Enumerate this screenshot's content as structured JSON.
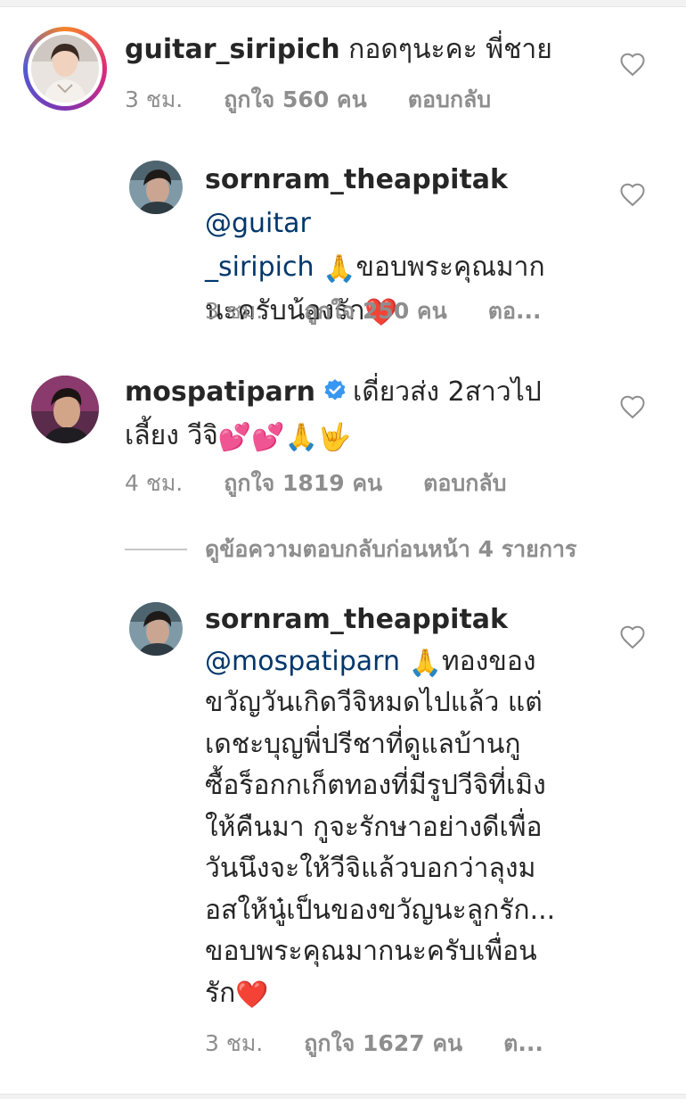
{
  "comments": [
    {
      "username": "guitar_siripich",
      "text": "กอดๆนะคะ พี่ชาย",
      "time": "3 ชม.",
      "likes": "ถูกใจ 560 คน",
      "reply": "ตอบกลับ"
    },
    {
      "username": "sornram_theappitak",
      "mention_part1": "@guitar",
      "mention_part2": "_siripich",
      "line2_text": "ขอบพระคุณมาก",
      "line3_text": "นะครับน้องรัก",
      "emoji_pray": "🙏",
      "emoji_heart": "❤️",
      "time": "3 ชม.",
      "likes": "ถูกใจ 250 คน",
      "reply": "ตอ..."
    },
    {
      "username": "mospatiparn",
      "line1_text": "เดี่ยวส่ง 2สาวไป",
      "line2_text": "เลี้ยง วีจิ",
      "emojis": "💕💕🙏🤟",
      "time": "4 ชม.",
      "likes": "ถูกใจ 1819 คน",
      "reply": "ตอบกลับ"
    },
    {
      "username": "sornram_theappitak",
      "mention": "@mospatiparn",
      "emoji_pray": "🙏",
      "lines": [
        "ทองของ",
        "ขวัญวันเกิดวีจิหมดไปแล้ว แต่",
        "เดชะบุญพี่ปรีชาที่ดูแลบ้านกู",
        "ซื้อร็อกกเก็ตทองที่มีรูปวีจิที่เมิง",
        "ให้คืนมา กูจะรักษาอย่างดีเพื่อ",
        "วันนึงจะให้วีจิแล้วบอกว่าลุงม",
        "อสให้นู๋เป็นของขวัญนะลูกรัก...",
        "ขอบพระคุณมากนะครับเพื่อน",
        "รัก"
      ],
      "emoji_heart": "❤️",
      "time": "3 ชม.",
      "likes": "ถูกใจ 1627 คน",
      "reply": "ต..."
    }
  ],
  "view_replies": "ดูข้อความตอบกลับก่อนหน้า 4 รายการ",
  "colors": {
    "verified": "#3897f0",
    "mention": "#00376b",
    "meta": "#8e8e8e",
    "heart_red": "#e0001b"
  },
  "icons": {
    "like": "heart-outline-icon",
    "verified": "verified-badge-icon"
  }
}
